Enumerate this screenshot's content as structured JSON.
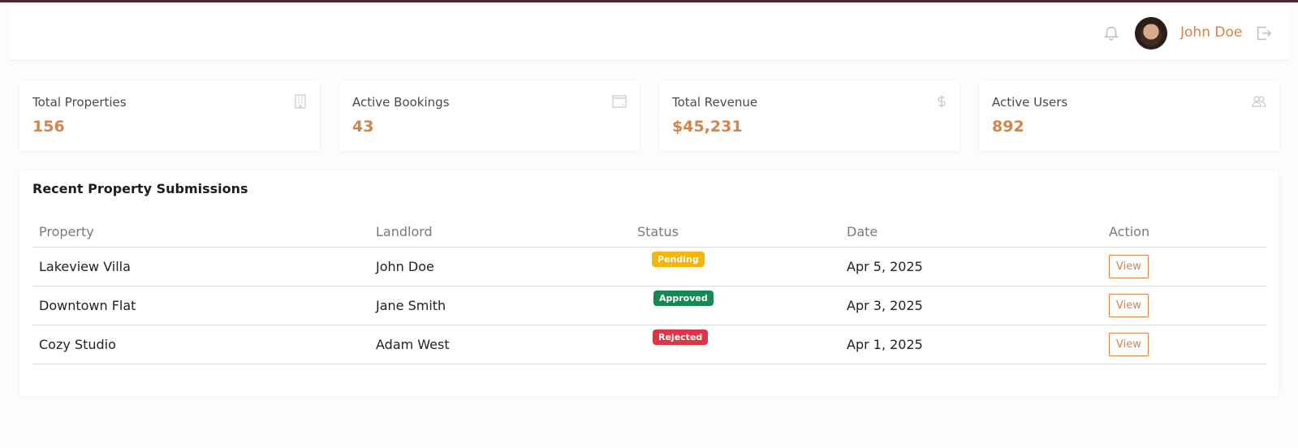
{
  "header": {
    "user_name": "John Doe",
    "icons": [
      "bell-icon",
      "avatar",
      "logout-icon"
    ]
  },
  "stats": [
    {
      "label": "Total Properties",
      "value": "156",
      "icon": "building-icon"
    },
    {
      "label": "Active Bookings",
      "value": "43",
      "icon": "calendar-icon"
    },
    {
      "label": "Total Revenue",
      "value": "$45,231",
      "icon": "dollar-icon"
    },
    {
      "label": "Active Users",
      "value": "892",
      "icon": "users-icon"
    }
  ],
  "submissions": {
    "title": "Recent Property Submissions",
    "columns": [
      "Property",
      "Landlord",
      "Status",
      "Date",
      "Action"
    ],
    "rows": [
      {
        "property": "Lakeview Villa",
        "landlord": "John Doe",
        "status": "Pending",
        "date": "Apr 5, 2025",
        "action": "View"
      },
      {
        "property": "Downtown Flat",
        "landlord": "Jane Smith",
        "status": "Approved",
        "date": "Apr 3, 2025",
        "action": "View"
      },
      {
        "property": "Cozy Studio",
        "landlord": "Adam West",
        "status": "Rejected",
        "date": "Apr 1, 2025",
        "action": "View"
      }
    ]
  },
  "colors": {
    "accent": "#d4834a",
    "pending": "#f5b50a",
    "approved": "#198754",
    "rejected": "#dc3545"
  }
}
